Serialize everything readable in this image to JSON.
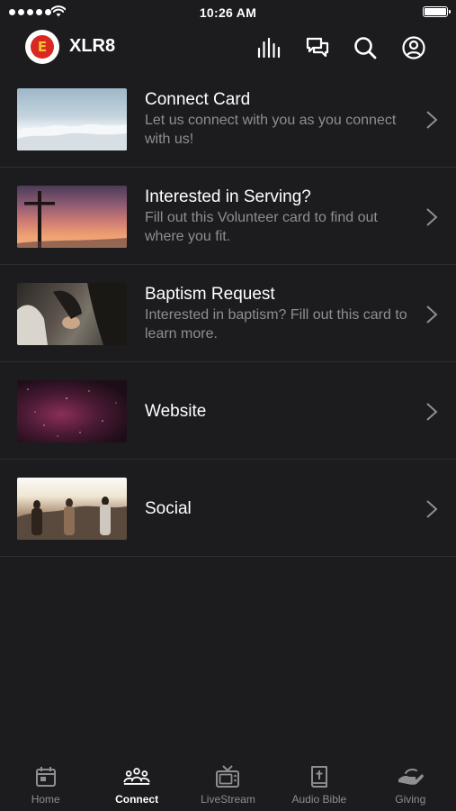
{
  "status_bar": {
    "time": "10:26 AM"
  },
  "header": {
    "app_title": "XLR8",
    "logo_letter": "E",
    "icons": [
      "audio-bars-icon",
      "chat-bubbles-icon",
      "search-icon",
      "account-icon"
    ]
  },
  "list": {
    "items": [
      {
        "title": "Connect Card",
        "subtitle": "Let us connect with you as you connect with us!",
        "thumb": "clouds"
      },
      {
        "title": "Interested in Serving?",
        "subtitle": "Fill out this Volunteer card to find out where you fit.",
        "thumb": "cross-sunset"
      },
      {
        "title": "Baptism Request",
        "subtitle": "Interested in baptism?  Fill out this card to learn more.",
        "thumb": "prayer"
      },
      {
        "title": "Website",
        "subtitle": "",
        "thumb": "galaxy"
      },
      {
        "title": "Social",
        "subtitle": "",
        "thumb": "friends-sunset"
      }
    ]
  },
  "tab_bar": {
    "tabs": [
      {
        "label": "Home",
        "icon": "calendar-icon",
        "active": false
      },
      {
        "label": "Connect",
        "icon": "people-icon",
        "active": true
      },
      {
        "label": "LiveStream",
        "icon": "tv-icon",
        "active": false
      },
      {
        "label": "Audio Bible",
        "icon": "bible-icon",
        "active": false
      },
      {
        "label": "Giving",
        "icon": "giving-hand-icon",
        "active": false
      }
    ]
  },
  "colors": {
    "background": "#1c1c1e",
    "divider": "#2e2e31",
    "text_primary": "#ffffff",
    "text_secondary": "#8e8e93",
    "logo_red": "#d8281f",
    "logo_yellow": "#f2c230"
  }
}
